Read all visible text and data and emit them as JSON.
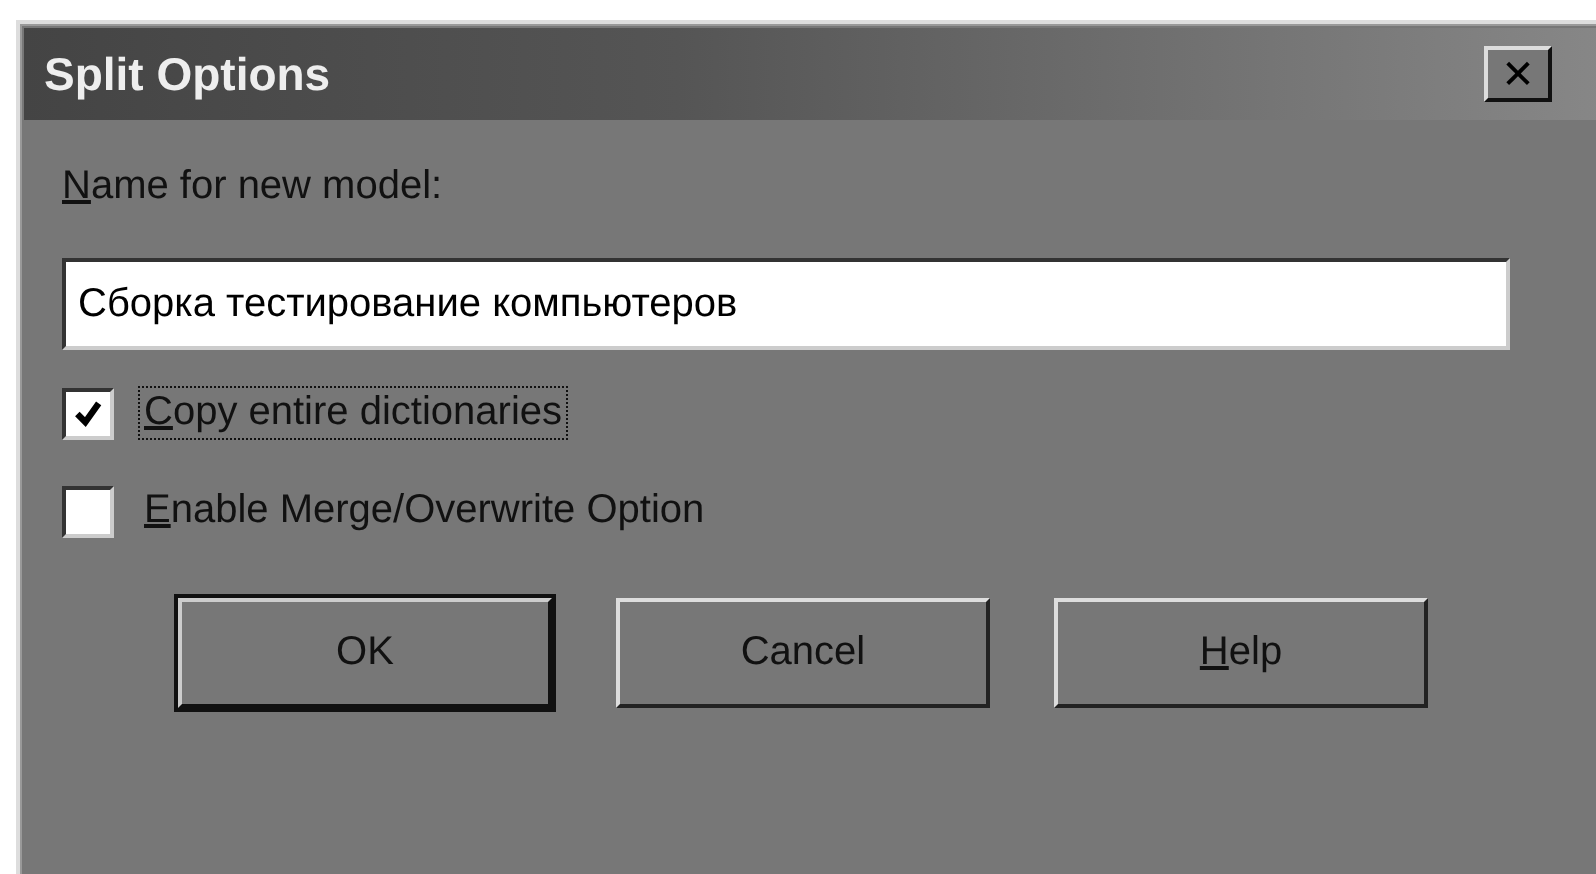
{
  "window": {
    "title": "Split Options",
    "close": "✕"
  },
  "name_label": {
    "key": "N",
    "rest": "ame for new model:"
  },
  "name_field": {
    "value": "Сборка тестирование компьютеров"
  },
  "checkboxes": [
    {
      "key": "C",
      "rest": "opy entire dictionaries",
      "checked": true,
      "focused": true
    },
    {
      "key": "E",
      "rest": "nable Merge/Overwrite Option",
      "checked": false,
      "focused": false
    }
  ],
  "buttons": [
    {
      "rest": "OK",
      "default": true
    },
    {
      "rest": "Cancel",
      "default": false
    },
    {
      "key": "H",
      "rest": "elp",
      "default": false
    }
  ]
}
